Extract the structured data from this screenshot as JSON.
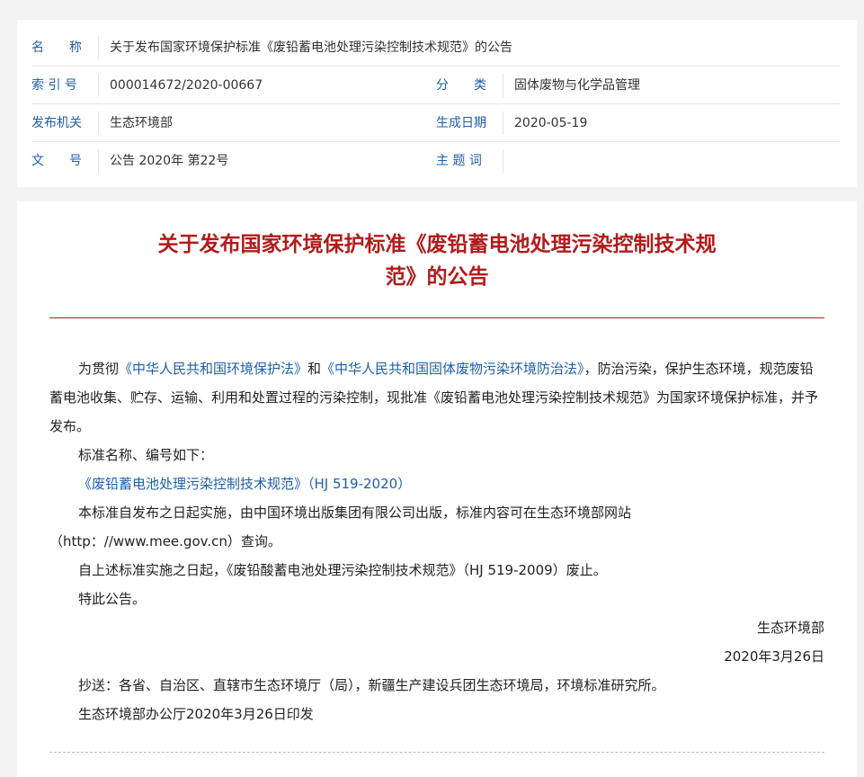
{
  "meta": {
    "name_label": "名　　称",
    "name_value": "关于发布国家环境保护标准《废铅蓄电池处理污染控制技术规范》的公告",
    "index_label": "索 引 号",
    "index_value": "000014672/2020-00667",
    "category_label": "分　　类",
    "category_value": "固体废物与化学品管理",
    "issuer_label": "发布机关",
    "issuer_value": "生态环境部",
    "date_label": "生成日期",
    "date_value": "2020-05-19",
    "docno_label": "文　　号",
    "docno_value": "公告 2020年 第22号",
    "keywords_label": "主 题 词",
    "keywords_value": ""
  },
  "document": {
    "title_line1": "关于发布国家环境保护标准《废铅蓄电池处理污染控制技术规",
    "title_line2": "范》的公告",
    "p1_a": "为贯彻",
    "p1_link1": "《中华人民共和国环境保护法》",
    "p1_b": "和",
    "p1_link2": "《中华人民共和国固体废物污染环境防治法》",
    "p1_c": "，防治污染，保护生态环境，规范废铅蓄电池收集、贮存、运输、利用和处置过程的污染控制，现批准《废铅蓄电池处理污染控制技术规范》为国家环境保护标准，并予发布。",
    "p2": "标准名称、编号如下：",
    "p3_link": "《废铅蓄电池处理污染控制技术规范》（HJ 519-2020）",
    "p4": "本标准自发布之日起实施，由中国环境出版集团有限公司出版，标准内容可在生态环境部网站",
    "p5": "（http：//www.mee.gov.cn）查询。",
    "p6": "自上述标准实施之日起，《废铅酸蓄电池处理污染控制技术规范》（HJ 519-2009）废止。",
    "p7": "特此公告。",
    "signature": "生态环境部",
    "sign_date": "2020年3月26日",
    "cc": "抄送：各省、自治区、直辖市生态环境厅（局），新疆生产建设兵团生态环境局，环境标准研究所。",
    "print_note": "生态环境部办公厅2020年3月26日印发"
  }
}
